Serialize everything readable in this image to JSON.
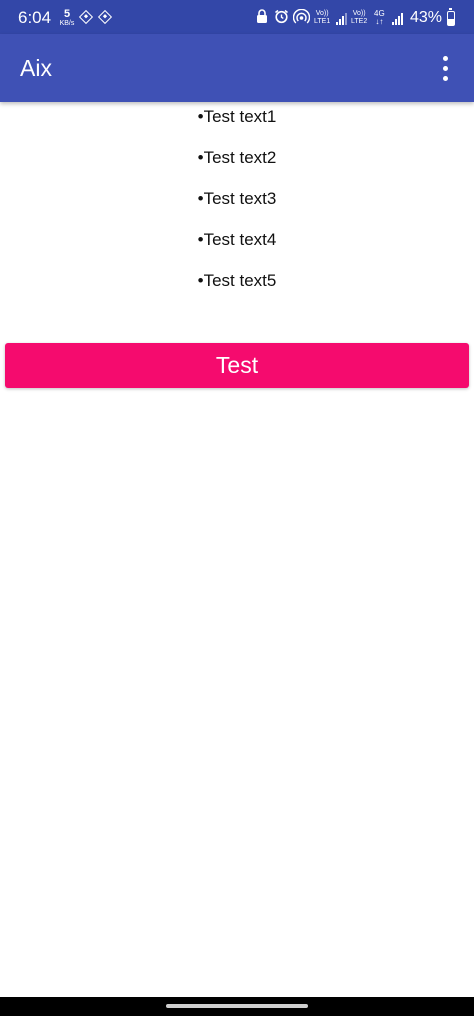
{
  "status_bar": {
    "time": "6:04",
    "net_speed_value": "5",
    "net_speed_unit": "KB/s",
    "sim1_label_top": "Vo))",
    "sim1_label_bottom": "LTE1",
    "sim2_label_top": "Vo))",
    "sim2_label_bottom": "LTE2",
    "network_type": "4G",
    "battery_percent": "43%",
    "battery_level": 0.43,
    "icons": [
      "binance-icon",
      "binance-icon",
      "lock-icon",
      "alarm-icon",
      "hotspot-icon",
      "signal-icon",
      "signal-icon",
      "battery-icon"
    ]
  },
  "app_bar": {
    "title": "Aix",
    "menu_icon": "more-vertical-icon"
  },
  "list": {
    "items": [
      {
        "text": "•Test text1"
      },
      {
        "text": "•Test text2"
      },
      {
        "text": "•Test text3"
      },
      {
        "text": "•Test text4"
      },
      {
        "text": "•Test text5"
      }
    ]
  },
  "button": {
    "label": "Test"
  },
  "colors": {
    "status_bar": "#3347a8",
    "app_bar": "#3f51b5",
    "accent_button": "#f50b6e",
    "text": "#111111",
    "background": "#ffffff"
  }
}
